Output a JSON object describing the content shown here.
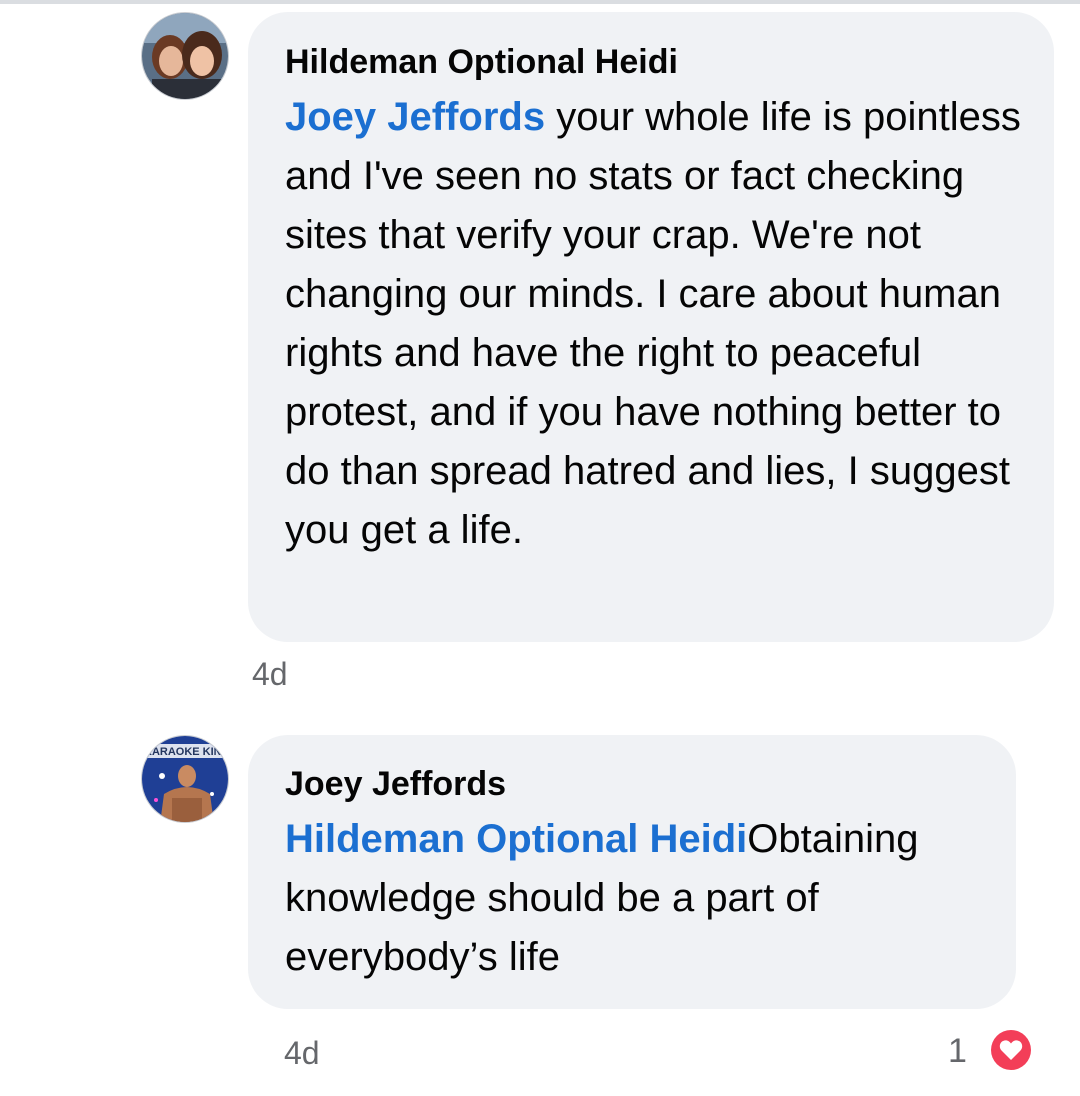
{
  "comments": [
    {
      "author": "Hildeman Optional Heidi",
      "mention": "Joey Jeffords",
      "text": " your whole life is pointless and I've seen no stats or fact checking sites that verify your crap. We're not changing our minds. I care about human rights and have the right to peaceful protest, and if you have nothing better to do than spread hatred and lies, I suggest you get a life.",
      "timestamp": "4d",
      "avatar_icon": "profile-photo-two-women"
    },
    {
      "author": "Joey Jeffords",
      "mention": "Hildeman Optional Heidi",
      "text": "Obtaining knowledge should be a part of everybody’s life",
      "timestamp": "4d",
      "avatar_icon": "profile-photo-karaoke-king",
      "avatar_caption": "KARAOKE KIN",
      "reaction_count": "1",
      "reaction_icon": "love-heart-icon"
    }
  ],
  "colors": {
    "bubble": "#f0f2f5",
    "mention": "#1b6fd1",
    "timestamp": "#65676b",
    "love_reaction": "#f33e58"
  }
}
